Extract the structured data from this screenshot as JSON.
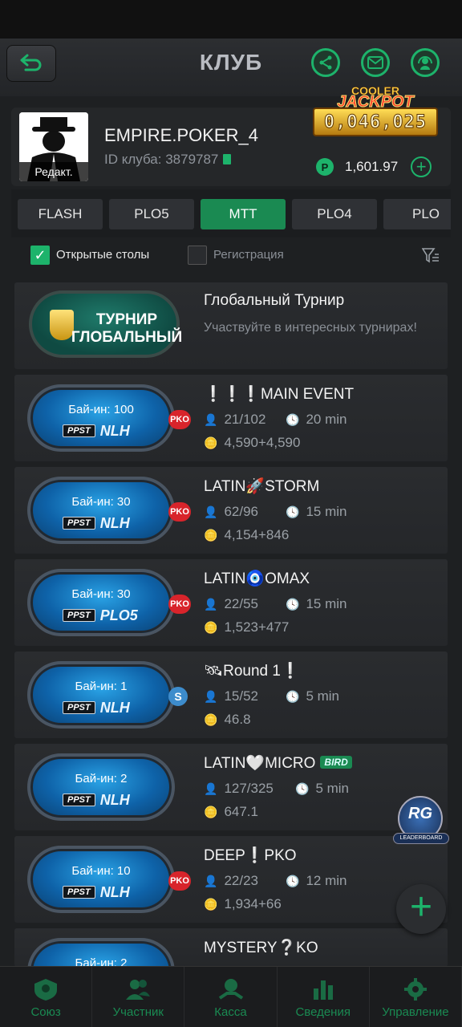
{
  "header": {
    "title": "КЛУБ"
  },
  "club": {
    "name": "EMPIRE.POKER_4",
    "id_label": "ID клуба: 3879787",
    "avatar_edit": "Редакт.",
    "jackpot_cooler": "COOLER",
    "jackpot_label": "JACKPOT",
    "jackpot_value": "0,046,025",
    "balance": "1,601.97",
    "coin_symbol": "P"
  },
  "tabs": [
    "FLASH",
    "PLO5",
    "MTT",
    "PLO4",
    "PLO"
  ],
  "active_tab": "MTT",
  "filters": {
    "open_tables": "Открытые столы",
    "registration": "Регистрация"
  },
  "global": {
    "logo_line1": "ТУРНИР",
    "logo_line2": "ГЛОБАЛЬНЫЙ",
    "title": "Глобальный Турнир",
    "subtitle": "Участвуйте в интересных турнирах!"
  },
  "tournaments": [
    {
      "title": "❕❕❕MAIN EVENT",
      "buyin": "Бай-ин: 100",
      "game": "NLH",
      "badge": "PKO",
      "players": "21/102",
      "time": "20 min",
      "prize": "4,590+4,590"
    },
    {
      "title": "LATIN🚀STORM",
      "buyin": "Бай-ин: 30",
      "game": "NLH",
      "badge": "PKO",
      "players": "62/96",
      "time": "15 min",
      "prize": "4,154+846"
    },
    {
      "title": "LATIN🧿OMAX",
      "buyin": "Бай-ин: 30",
      "game": "PLO5",
      "badge": "PKO",
      "players": "22/55",
      "time": "15 min",
      "prize": "1,523+477"
    },
    {
      "title": "🛰Round 1❕",
      "buyin": "Бай-ин: 1",
      "game": "NLH",
      "badge": "S",
      "players": "15/52",
      "time": "5 min",
      "prize": "46.8"
    },
    {
      "title": "LATIN🤍MICRO",
      "tag": "BIRD",
      "buyin": "Бай-ин: 2",
      "game": "NLH",
      "badge": "",
      "players": "127/325",
      "time": "5 min",
      "prize": "647.1"
    },
    {
      "title": "DEEP❕PKO",
      "buyin": "Бай-ин: 10",
      "game": "NLH",
      "badge": "PKO",
      "players": "22/23",
      "time": "12 min",
      "prize": "1,934+66"
    },
    {
      "title": "MYSTERY❔KO",
      "buyin": "Бай-ин: 2",
      "game": "",
      "badge": ""
    }
  ],
  "ppst_label": "PPST",
  "leaderboard": {
    "logo": "RG",
    "label": "LEADERBOARD"
  },
  "fab_symbol": "+",
  "bottom_nav": [
    "Союз",
    "Участник",
    "Касса",
    "Сведения",
    "Управление"
  ],
  "colors": {
    "accent": "#1db36b",
    "pko": "#d8242b",
    "bg": "#1e2022"
  }
}
